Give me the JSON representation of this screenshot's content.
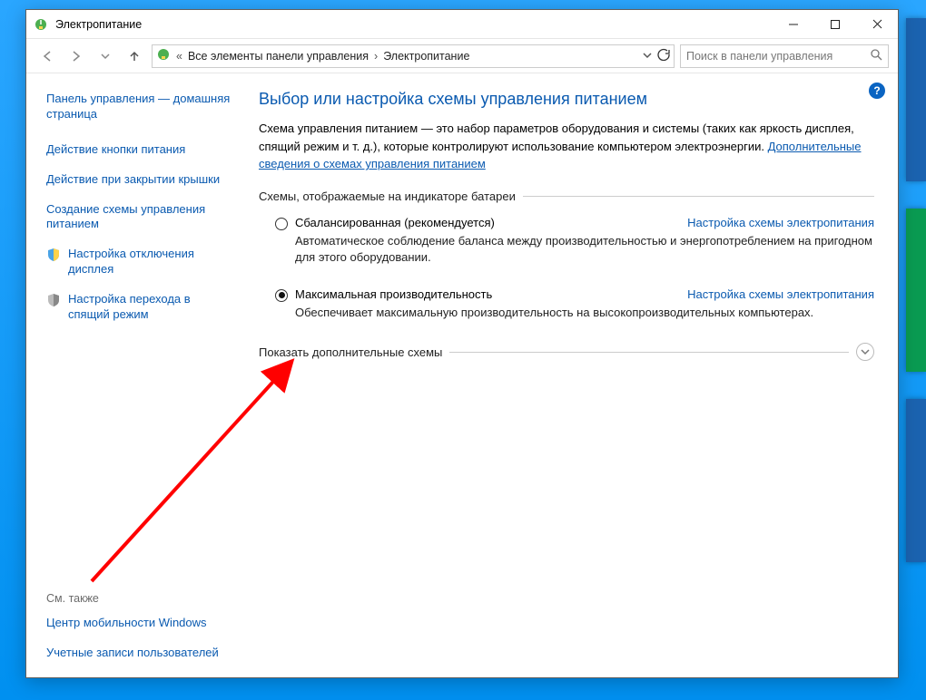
{
  "titlebar": {
    "title": "Электропитание"
  },
  "addr": {
    "crumb_parent": "Все элементы панели управления",
    "crumb_current": "Электропитание",
    "search_placeholder": "Поиск в панели управления"
  },
  "sidebar": {
    "home1": "Панель управления — домашняя страница",
    "links": [
      "Действие кнопки питания",
      "Действие при закрытии крышки",
      "Создание схемы управления питанием"
    ],
    "iconlinks": [
      "Настройка отключения дисплея",
      "Настройка перехода в спящий режим"
    ],
    "see_also_title": "См. также",
    "see_also": [
      "Центр мобильности Windows",
      "Учетные записи пользователей"
    ]
  },
  "main": {
    "title": "Выбор или настройка схемы управления питанием",
    "intro_pre": "Схема управления питанием — это набор параметров оборудования и системы (таких как яркость дисплея, спящий режим и т. д.), которые контролируют использование компьютером электроэнергии. ",
    "intro_link": "Дополнительные сведения о схемах управления питанием",
    "group_battery": "Схемы, отображаемые на индикаторе батареи",
    "plan1": {
      "name": "Сбалансированная (рекомендуется)",
      "link": "Настройка схемы электропитания",
      "desc": "Автоматическое соблюдение баланса между производительностью и энергопотреблением на пригодном для этого оборудовании."
    },
    "plan2": {
      "name": "Максимальная производительность",
      "link": "Настройка схемы электропитания",
      "desc": "Обеспечивает максимальную производительность на высокопроизводительных компьютерах."
    },
    "expander": "Показать дополнительные схемы",
    "help_symbol": "?"
  },
  "colors": {
    "link": "#0a5ab0",
    "arrow": "#ff0000"
  }
}
